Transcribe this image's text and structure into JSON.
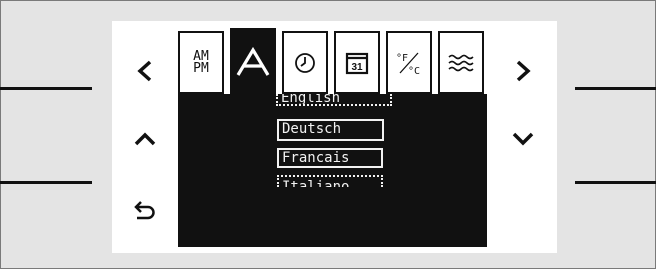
{
  "tabs": [
    {
      "id": "clock-format",
      "label_line1": "AM",
      "label_line2": "PM",
      "icon": "am-pm-icon"
    },
    {
      "id": "language",
      "label": "A",
      "icon": "language-icon",
      "active": true
    },
    {
      "id": "time",
      "icon": "clock-icon"
    },
    {
      "id": "date",
      "label": "31",
      "icon": "calendar-icon"
    },
    {
      "id": "temperature-unit",
      "label": "°F/°C",
      "icon": "temperature-unit-icon"
    },
    {
      "id": "water-hardness",
      "icon": "water-hardness-icon"
    }
  ],
  "languages": [
    {
      "label": "English",
      "state": "partial-top"
    },
    {
      "label": "Deutsch",
      "state": "selected"
    },
    {
      "label": "Francais",
      "state": "normal"
    },
    {
      "label": "Italiano",
      "state": "partial-bottom"
    }
  ],
  "nav": {
    "left": "chevron-left-icon",
    "right": "chevron-right-icon",
    "up": "chevron-up-icon",
    "down": "chevron-down-icon",
    "back": "back-arrow-icon"
  },
  "colors": {
    "background": "#e4e4e4",
    "screen": "#ffffff",
    "panel": "#111111",
    "text_on_panel": "#f2f2f2"
  }
}
